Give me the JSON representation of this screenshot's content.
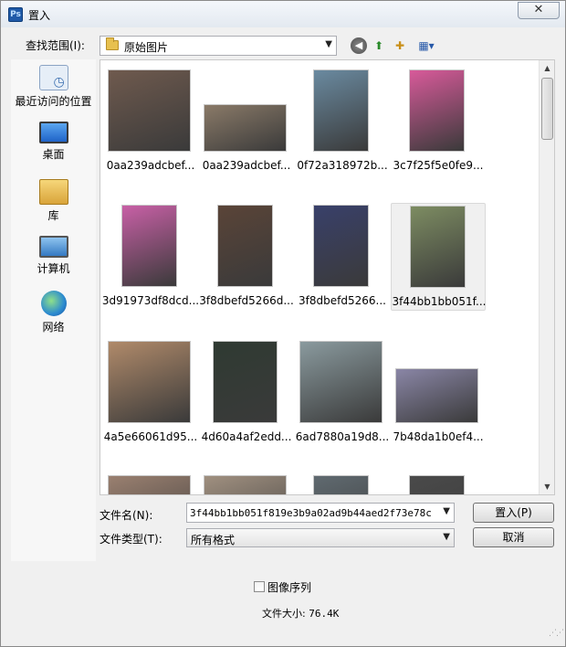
{
  "window": {
    "title": "置入",
    "icon_text": "Ps",
    "close_symbol": "✕"
  },
  "lookin": {
    "label": "查找范围(I):",
    "value": "原始图片"
  },
  "toolbar": {
    "back": "◀",
    "up": "⬆",
    "new_folder": "✚",
    "views": "▦▾"
  },
  "places": [
    {
      "label": "最近访问的位置",
      "icon": "recent-places-icon"
    },
    {
      "label": "桌面",
      "icon": "desktop-icon"
    },
    {
      "label": "库",
      "icon": "libraries-icon"
    },
    {
      "label": "计算机",
      "icon": "computer-icon"
    },
    {
      "label": "网络",
      "icon": "network-icon"
    }
  ],
  "files": [
    {
      "name": "0aa239adcbef...",
      "color": "#6f5a4e"
    },
    {
      "name": "0aa239adcbef...",
      "color": "#8a7a68"
    },
    {
      "name": "0f72a318972b...",
      "color": "#6a8aa0"
    },
    {
      "name": "3c7f25f5e0fe9...",
      "color": "#d85a9a"
    },
    {
      "name": "3d91973df8dcd...",
      "color": "#c860a6"
    },
    {
      "name": "3f8dbefd5266d...",
      "color": "#5a4438"
    },
    {
      "name": "3f8dbefd5266...",
      "color": "#39406a"
    },
    {
      "name": "3f44bb1bb051f...",
      "color": "#7d8c62"
    },
    {
      "name": "4a5e66061d95...",
      "color": "#b08a6a"
    },
    {
      "name": "4d60a4af2edd...",
      "color": "#2f3a32"
    },
    {
      "name": "6ad7880a19d8...",
      "color": "#8a9a9e"
    },
    {
      "name": "7b48da1b0ef4...",
      "color": "#8a86a6"
    },
    {
      "name": "",
      "color": "#9a8070"
    },
    {
      "name": "",
      "color": "#a09080"
    },
    {
      "name": "",
      "color": "#606a70"
    },
    {
      "name": "",
      "color": "#4a4a4a"
    }
  ],
  "filename": {
    "label": "文件名(N):",
    "value": "3f44bb1bb051f819e3b9a02ad9b44aed2f73e78c"
  },
  "filetype": {
    "label": "文件类型(T):",
    "value": "所有格式"
  },
  "buttons": {
    "place": "置入(P)",
    "cancel": "取消"
  },
  "image_sequence": {
    "label": "图像序列",
    "checked": false
  },
  "file_size": {
    "label": "文件大小:",
    "value": "76.4K"
  }
}
